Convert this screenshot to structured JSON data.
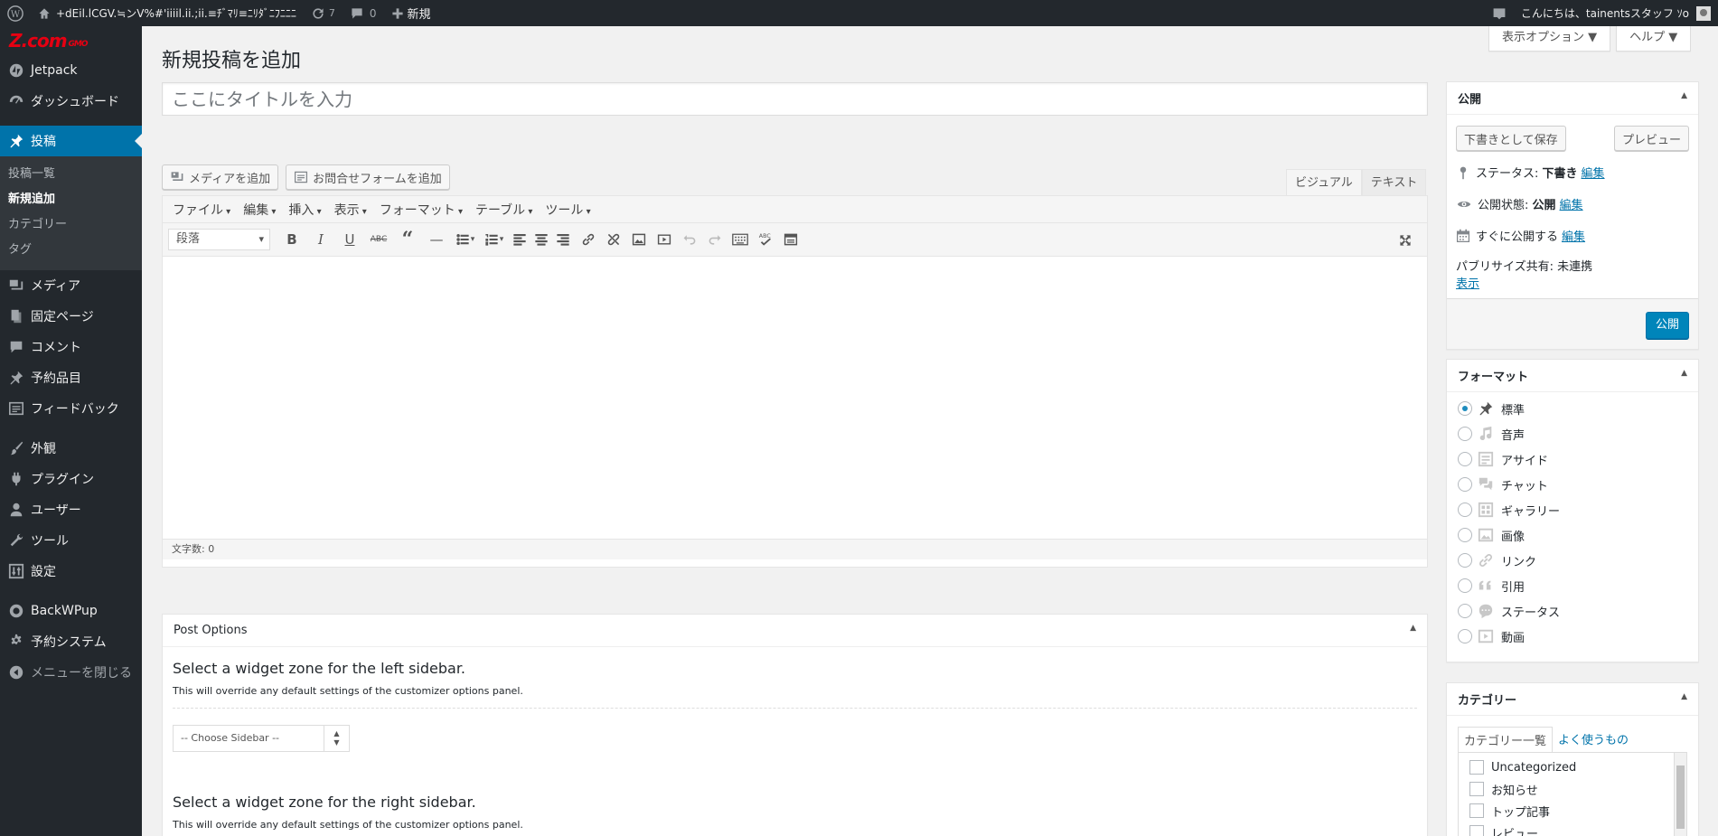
{
  "adminbar": {
    "site_name": "+dEil.lCGV.≒ンV%#'iiiil.ii.;ii.≡ﾁﾞﾏﾘ≡ﾆﾘﾀﾞﾆﾌﾆﾆﾆ",
    "updates_count": "7",
    "comments_count": "0",
    "new_label": "新規",
    "greeting": "こんにちは、tainentsスタッフ ｿo"
  },
  "sidebar": {
    "brand": "Z.com",
    "brand_sub": "GMO",
    "items_top": [
      {
        "label": "Jetpack",
        "icon": "jetpack-icon"
      },
      {
        "label": "ダッシュボード",
        "icon": "dashboard-icon"
      }
    ],
    "current": {
      "label": "投稿",
      "icon": "pin-icon"
    },
    "submenu": [
      "投稿一覧",
      "新規追加",
      "カテゴリー",
      "タグ"
    ],
    "items_mid": [
      {
        "label": "メディア",
        "icon": "media-icon"
      },
      {
        "label": "固定ページ",
        "icon": "page-icon"
      },
      {
        "label": "コメント",
        "icon": "comment-icon"
      },
      {
        "label": "予約品目",
        "icon": "pin-icon"
      },
      {
        "label": "フィードバック",
        "icon": "feedback-icon"
      }
    ],
    "items_bottom": [
      {
        "label": "外観",
        "icon": "brush-icon"
      },
      {
        "label": "プラグイン",
        "icon": "plugin-icon"
      },
      {
        "label": "ユーザー",
        "icon": "user-icon"
      },
      {
        "label": "ツール",
        "icon": "wrench-icon"
      },
      {
        "label": "設定",
        "icon": "settings-icon"
      }
    ],
    "items_extra": [
      {
        "label": "BackWPup",
        "icon": "backwpup-icon"
      },
      {
        "label": "予約システム",
        "icon": "gear-icon"
      }
    ],
    "collapse_label": "メニューを閉じる"
  },
  "screen_meta": {
    "options_label": "表示オプション ▼",
    "help_label": "ヘルプ ▼"
  },
  "page_title": "新規投稿を追加",
  "title_placeholder": "ここにタイトルを入力",
  "media_buttons": {
    "add_media": "メディアを追加",
    "add_form": "お問合せフォームを追加"
  },
  "editor": {
    "tab_visual": "ビジュアル",
    "tab_text": "テキスト",
    "menubar": [
      "ファイル",
      "編集",
      "挿入",
      "表示",
      "フォーマット",
      "テーブル",
      "ツール"
    ],
    "format_select": "段落",
    "word_count": "文字数: 0"
  },
  "post_options": {
    "title": "Post Options",
    "left_heading": "Select a widget zone for the left sidebar.",
    "left_desc": "This will override any default settings of the customizer options panel.",
    "select_value": "-- Choose Sidebar --",
    "right_heading": "Select a widget zone for the right sidebar.",
    "right_desc": "This will override any default settings of the customizer options panel."
  },
  "publish": {
    "title": "公開",
    "save_draft": "下書きとして保存",
    "preview": "プレビュー",
    "status_label": "ステータス:",
    "status_value": "下書き",
    "visibility_label": "公開状態:",
    "visibility_value": "公開",
    "schedule": "すぐに公開する",
    "edit_label": "編集",
    "share_label": "パブリサイズ共有: 未連携",
    "show_label": "表示",
    "publish_button": "公開"
  },
  "format_box": {
    "title": "フォーマット",
    "options": [
      {
        "label": "標準",
        "icon": "pin-icon",
        "selected": true
      },
      {
        "label": "音声",
        "icon": "audio-icon",
        "selected": false
      },
      {
        "label": "アサイド",
        "icon": "aside-icon",
        "selected": false
      },
      {
        "label": "チャット",
        "icon": "chat-icon",
        "selected": false
      },
      {
        "label": "ギャラリー",
        "icon": "gallery-icon",
        "selected": false
      },
      {
        "label": "画像",
        "icon": "image-icon",
        "selected": false
      },
      {
        "label": "リンク",
        "icon": "link-icon",
        "selected": false
      },
      {
        "label": "引用",
        "icon": "quote-icon",
        "selected": false
      },
      {
        "label": "ステータス",
        "icon": "status-icon",
        "selected": false
      },
      {
        "label": "動画",
        "icon": "video-icon",
        "selected": false
      }
    ]
  },
  "category_box": {
    "title": "カテゴリー",
    "tab_all": "カテゴリー一覧",
    "tab_popular": "よく使うもの",
    "items": [
      "Uncategorized",
      "お知らせ",
      "トップ記事",
      "レビュー"
    ]
  },
  "colors": {
    "admin_dark": "#23282d",
    "accent": "#0073aa",
    "primary_button": "#0085ba",
    "brand_red": "#e60012"
  }
}
